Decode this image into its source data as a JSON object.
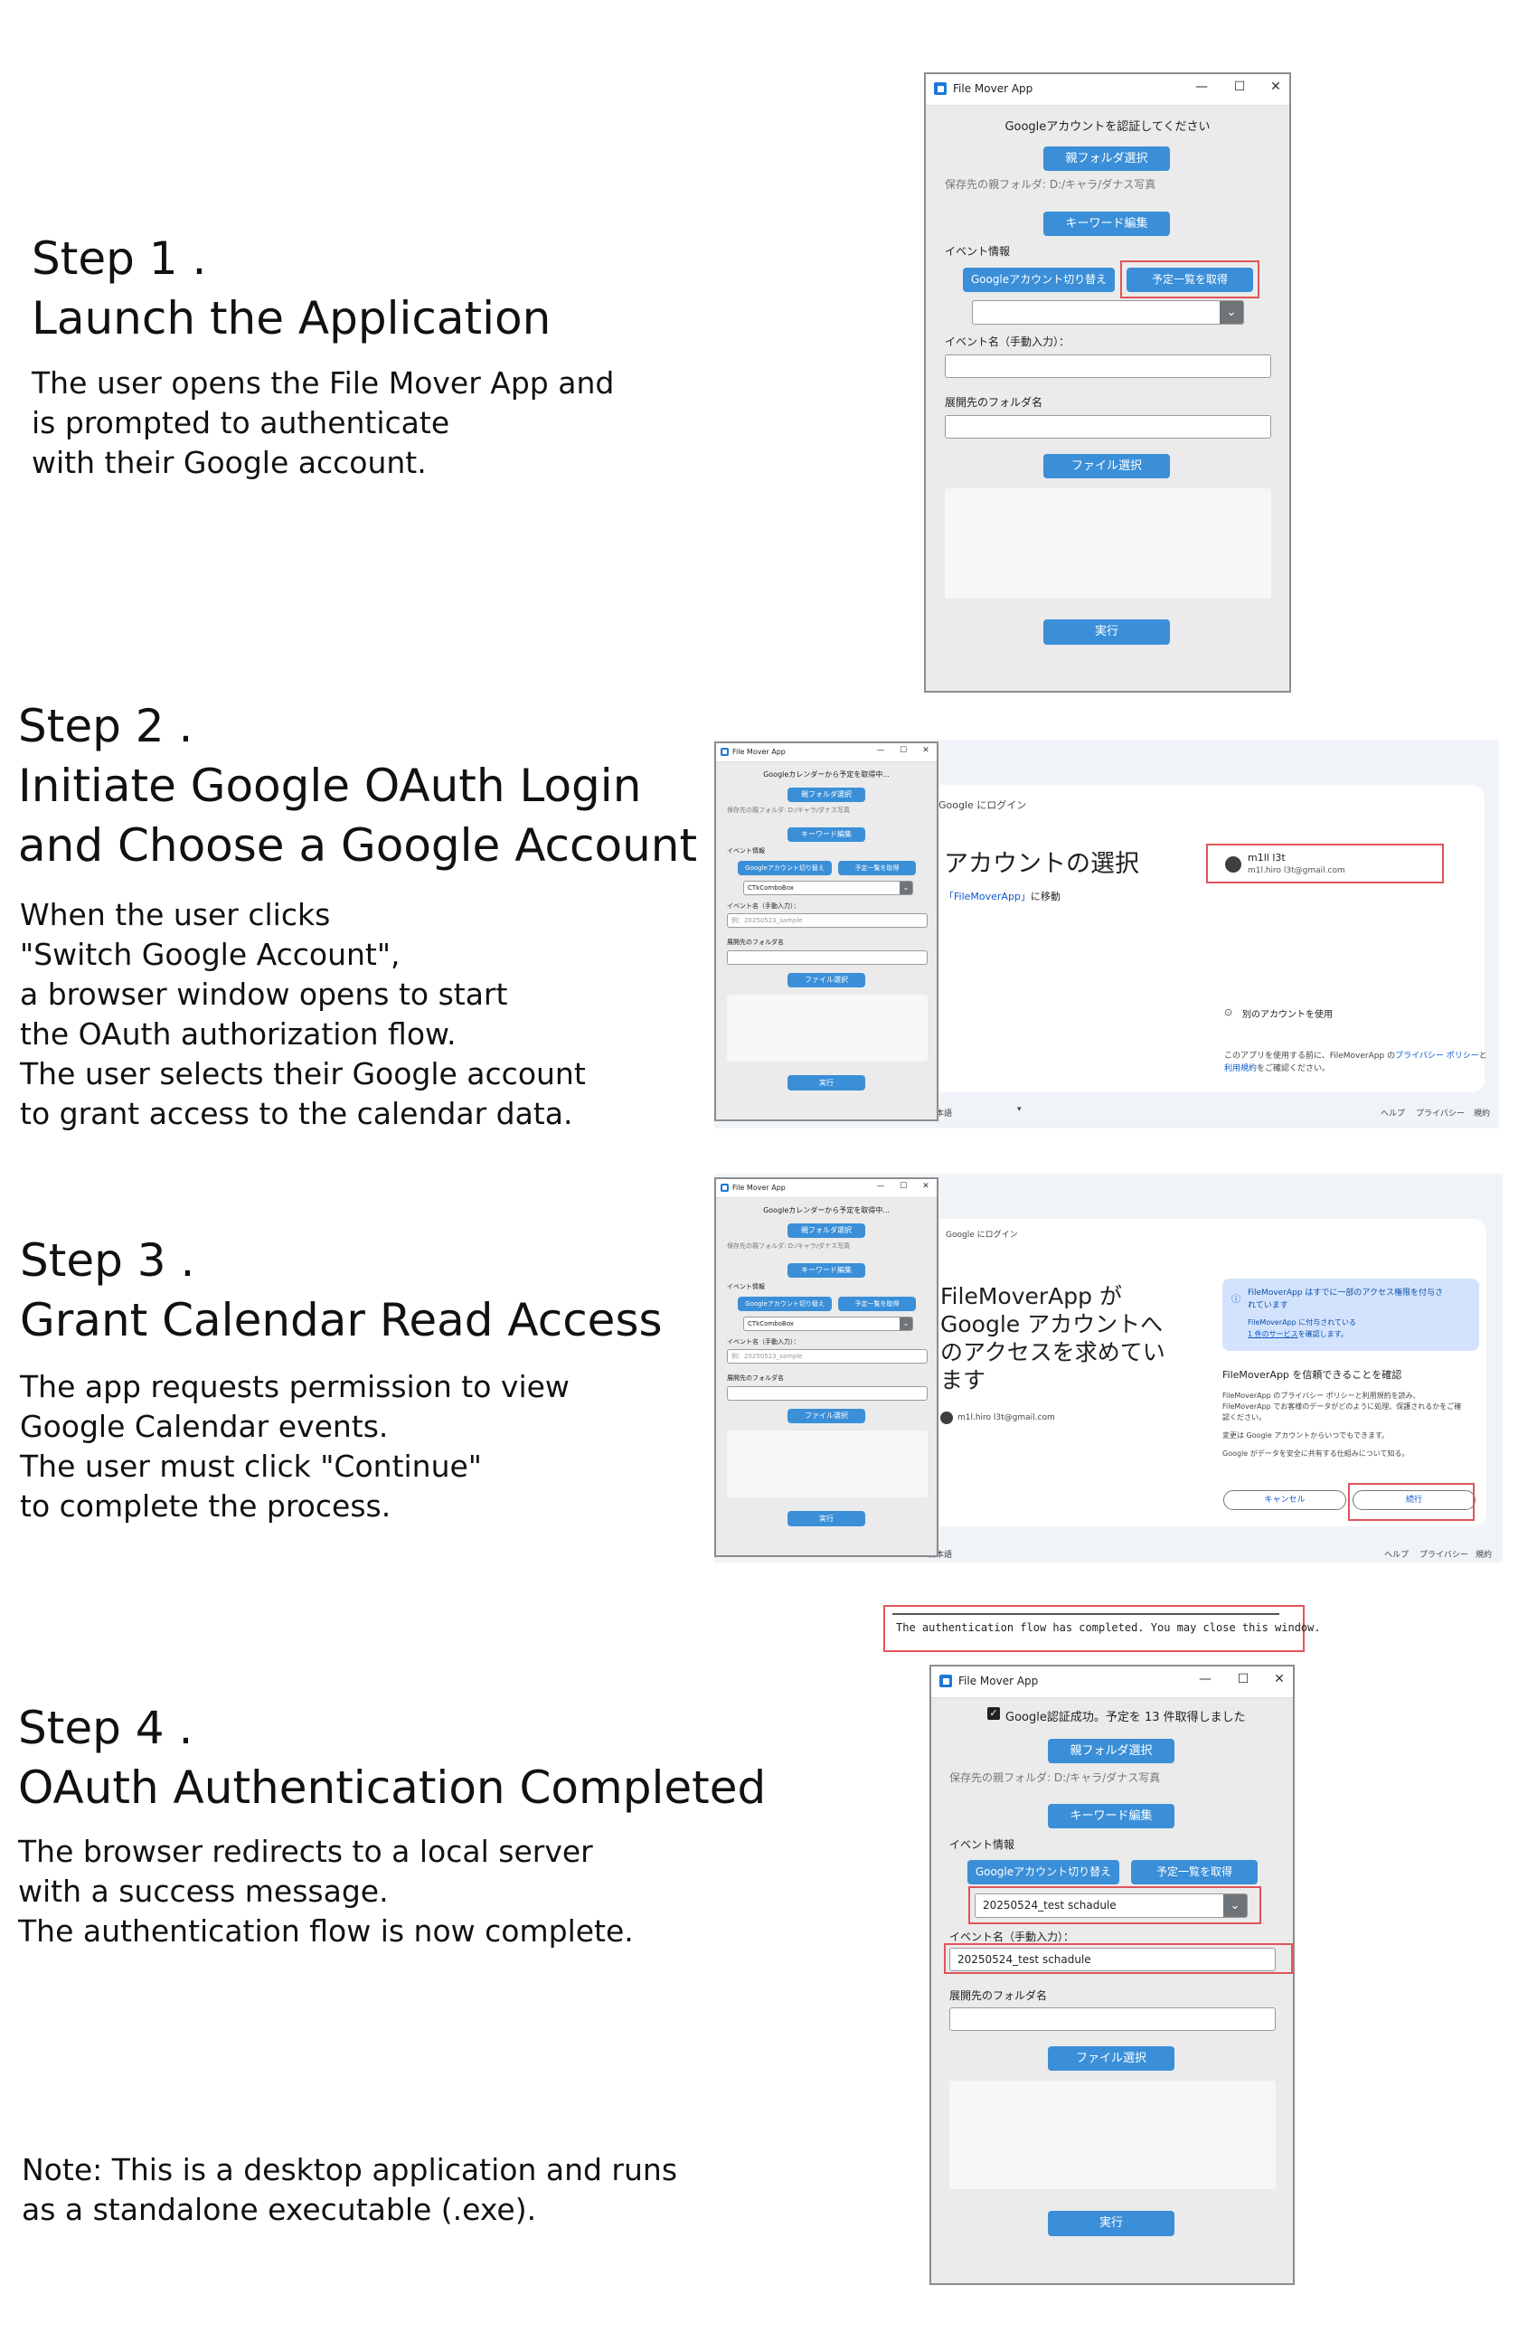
{
  "steps": [
    {
      "title_lines": [
        "Step 1 .",
        "Launch the Application"
      ],
      "desc_lines": [
        "The user opens the File Mover App and",
        "is prompted to authenticate",
        "with their Google account."
      ]
    },
    {
      "title_lines": [
        "Step 2 .",
        "Initiate Google OAuth Login",
        "and Choose a Google Account"
      ],
      "desc_lines": [
        "When the user clicks",
        "\"Switch Google Account\",",
        "a browser window opens to start",
        "the OAuth authorization flow.",
        "The user selects their Google account",
        "to grant access to the calendar data."
      ]
    },
    {
      "title_lines": [
        "Step 3 .",
        "Grant Calendar Read Access"
      ],
      "desc_lines": [
        "The app requests permission to view",
        "Google Calendar events.",
        "The user must click \"Continue\"",
        "to complete the process."
      ]
    },
    {
      "title_lines": [
        "Step 4 .",
        "OAuth Authentication Completed"
      ],
      "desc_lines": [
        "The browser redirects to a local server",
        "with a success message.",
        "The authentication flow is now complete."
      ]
    }
  ],
  "note_lines": [
    "Note: This is a desktop application and runs",
    "as a standalone executable (.exe)."
  ],
  "app": {
    "title": "File Mover App",
    "controls": {
      "minimize": "—",
      "maximize": "☐",
      "close": "✕"
    },
    "status_initial": "Googleアカウントを認証してください",
    "status_loading": "Googleカレンダーから予定を取得中...",
    "status_success": "Google認証成功。予定を 13 件取得しました",
    "check_mark": "✓",
    "parent_folder_button": "親フォルダ選択",
    "parent_folder_path": "保存先の親フォルダ: D:/キャラ/ダナス写真",
    "keyword_button": "キーワード編集",
    "event_info_label": "イベント情報",
    "switch_account_button": "Googleアカウント切り替え",
    "fetch_events_button": "予定一覧を取得",
    "combo_placeholder": "CTkComboBox",
    "combo_selected": "20250524_test schadule",
    "combo_arrow": "⌄",
    "event_name_label": "イベント名（手動入力）：",
    "event_name_placeholder": "例：20250523_sample",
    "event_name_value": "20250524_test schadule",
    "dest_folder_label": "展開先のフォルダ名",
    "file_select_button": "ファイル選択",
    "run_button": "実行"
  },
  "browser_step2": {
    "header": "Google にログイン",
    "heading": "アカウントの選択",
    "subtitle_link": "「FileMoverApp」",
    "subtitle_rest": "に移動",
    "account_name": "m1ll l3t",
    "account_email": "m1l.hiro l3t@gmail.com",
    "other_account": "別のアカウントを使用",
    "privacy_text_1": "このアプリを使用する前に、FileMoverApp の",
    "privacy_link": "プライバシー ポリシー",
    "privacy_text_2": "と",
    "terms_link": "利用規約",
    "privacy_text_3": "をご確認ください。",
    "footer_lang": "日本語",
    "footer_help": "ヘルプ",
    "footer_privacy": "プライバシー",
    "footer_terms": "規約"
  },
  "browser_step3": {
    "header": "Google にログイン",
    "heading_lines": [
      "FileMoverApp が",
      "Google アカウントへ",
      "のアクセスを求めてい",
      "ます"
    ],
    "account_email": "m1l.hiro l3t@gmail.com",
    "info_line1": "FileMoverApp はすでに一部のアクセス権限を付与さ",
    "info_line2": "れています",
    "info_line3": "FileMoverApp に付与されている",
    "info_link": "1 件のサービス",
    "info_line4": "を確認します。",
    "trust_heading": "FileMoverApp を信頼できることを確認",
    "trust_body_1": "FileMoverApp のプライバシー ポリシーと利用規約を読み、",
    "trust_body_2": "FileMoverApp でお客様のデータがどのように処理、保護されるかをご確",
    "trust_body_3": "認ください。",
    "change_text": "変更は Google アカウントからいつでもできます。",
    "share_text": "Google がデータを安全に共有する仕組みについて知る。",
    "cancel_button": "キャンセル",
    "continue_button": "続行",
    "footer_lang": "日本語",
    "footer_help": "ヘルプ",
    "footer_privacy": "プライバシー",
    "footer_terms": "規約"
  },
  "local_server_message": "The authentication flow has completed. You may close this window."
}
